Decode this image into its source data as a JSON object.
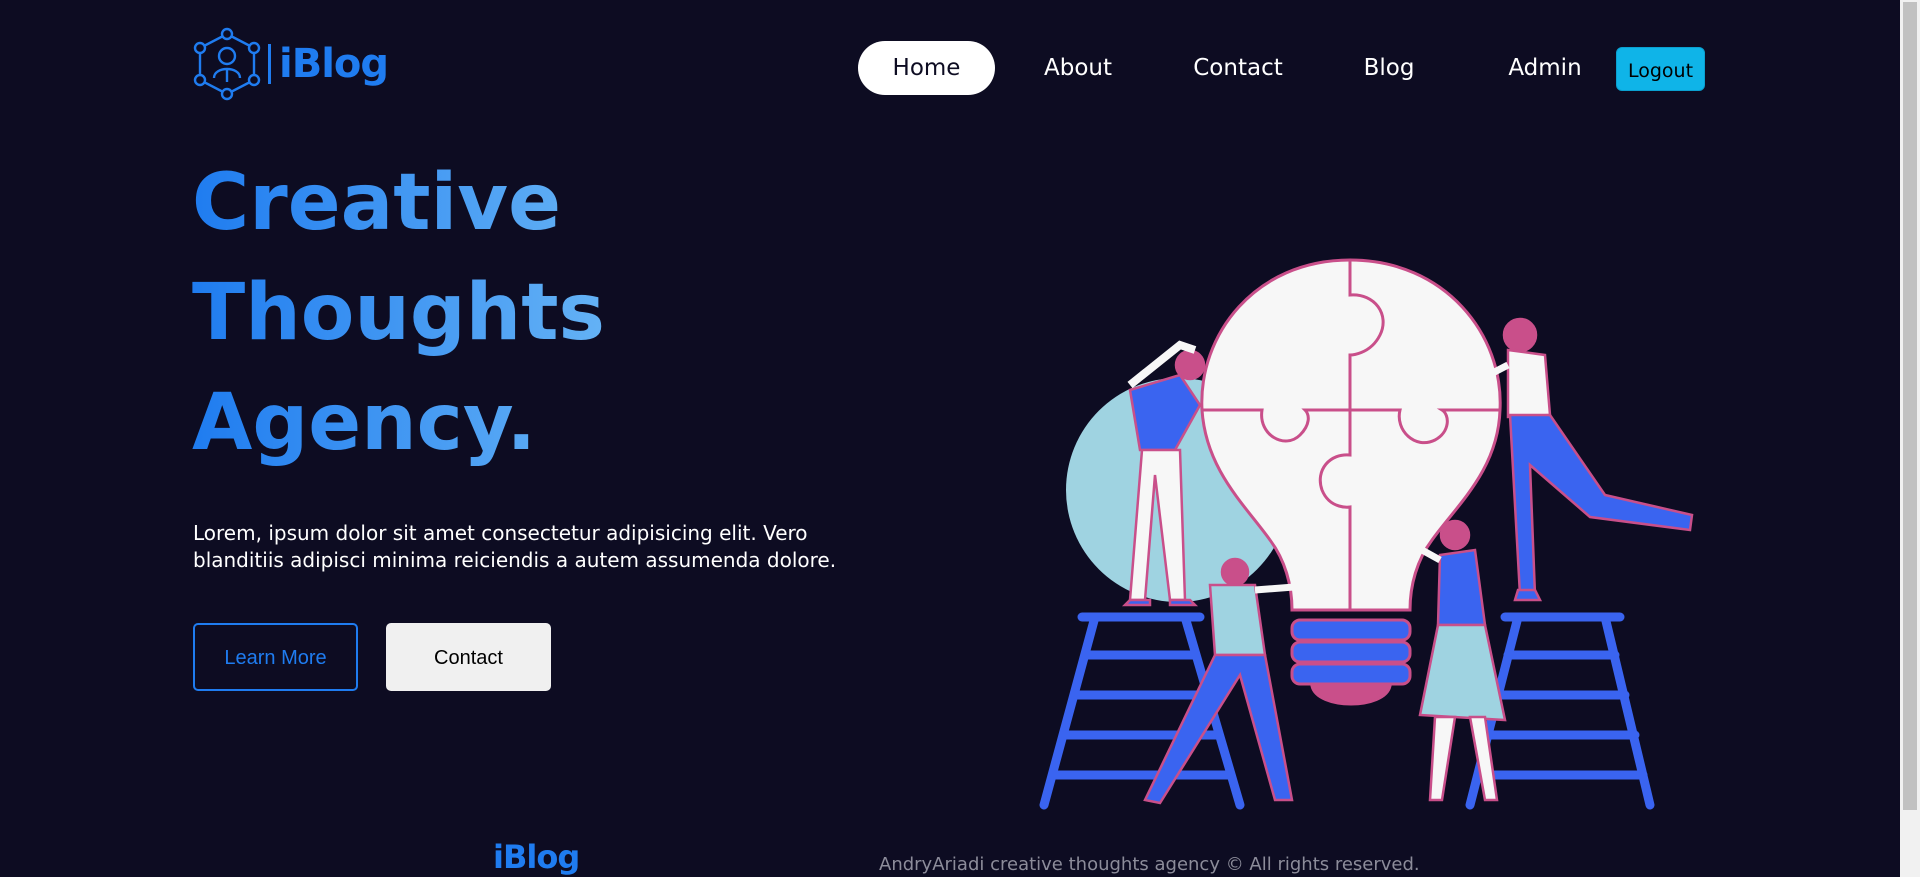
{
  "brand": {
    "logo_text": "iBlog",
    "primary_color": "#1f7cf0",
    "background_color": "#0d0c22"
  },
  "nav": {
    "items": [
      {
        "label": "Home",
        "active": true
      },
      {
        "label": "About",
        "active": false
      },
      {
        "label": "Contact",
        "active": false
      },
      {
        "label": "Blog",
        "active": false
      },
      {
        "label": "Admin",
        "active": false
      }
    ],
    "logout_label": "Logout",
    "logout_color": "#0fb4e8"
  },
  "hero": {
    "title_lines": [
      "Creative",
      "Thoughts",
      "Agency."
    ],
    "description": "Lorem, ipsum dolor sit amet consectetur adipisicing elit. Vero blanditiis adipisci minima reiciendis a autem assumenda dolore.",
    "learn_more_label": "Learn More",
    "contact_label": "Contact"
  },
  "footer": {
    "logo_text": "iBlog",
    "copyright": "AndryAriadi creative thoughts agency © All rights reserved."
  }
}
